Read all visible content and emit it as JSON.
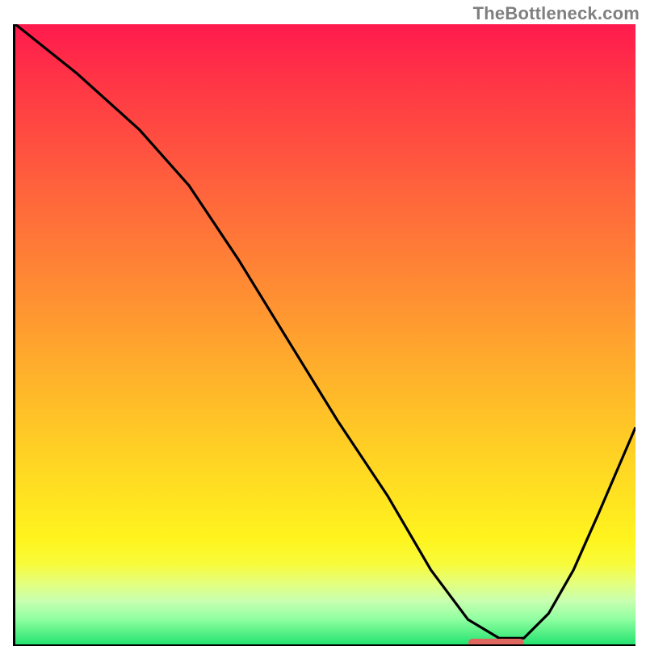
{
  "watermark": "TheBottleneck.com",
  "chart_data": {
    "type": "line",
    "title": "",
    "xlabel": "",
    "ylabel": "",
    "xlim": [
      0,
      1
    ],
    "ylim": [
      0,
      1
    ],
    "x": [
      0.0,
      0.1,
      0.2,
      0.28,
      0.36,
      0.44,
      0.52,
      0.6,
      0.67,
      0.73,
      0.78,
      0.82,
      0.86,
      0.9,
      0.94,
      1.0
    ],
    "values": [
      1.0,
      0.92,
      0.83,
      0.74,
      0.62,
      0.49,
      0.36,
      0.24,
      0.12,
      0.04,
      0.01,
      0.01,
      0.05,
      0.12,
      0.21,
      0.35
    ],
    "marker": {
      "x_start": 0.73,
      "x_end": 0.82,
      "y": 0.003
    },
    "gradient_note": "background encodes value: red=high bottleneck, green=low"
  },
  "colors": {
    "axis": "#000000",
    "curve": "#000000",
    "marker": "#e06760",
    "watermark": "#555555"
  }
}
